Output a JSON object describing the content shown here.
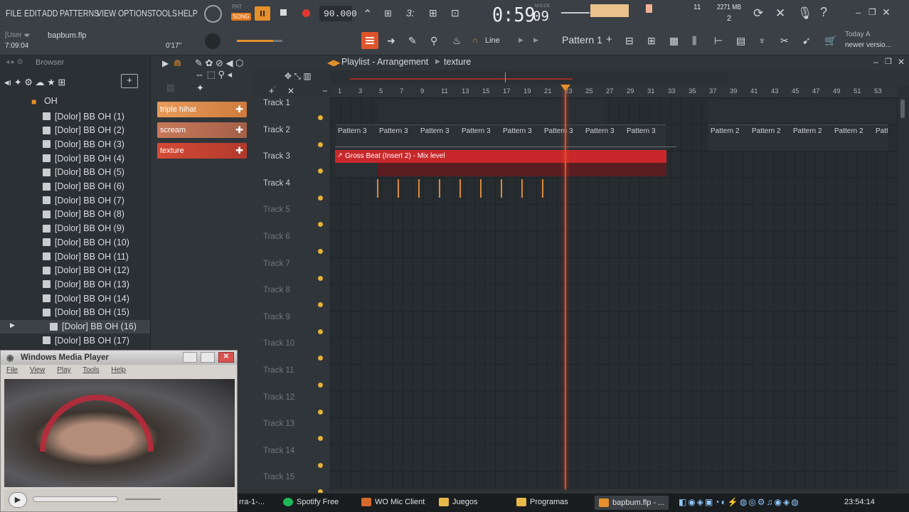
{
  "menu": {
    "items": [
      "FILE",
      "EDIT",
      "ADD",
      "PATTERNS",
      "VIEW",
      "OPTIONS",
      "TOOLS",
      "HELP"
    ],
    "pat_label": "PAT",
    "song_label": "SONG",
    "tempo": "90.000",
    "time_main": "0:59",
    "time_sub": "09",
    "time_unit": "M:S:CS",
    "cpu_value": "11",
    "mem": "2271 MB",
    "mem_sub": "2"
  },
  "hint": {
    "user": "[User",
    "file": "bapbum.flp",
    "duration": "7:09:04",
    "offset": "0'17\""
  },
  "toolbar": {
    "snap_mode": "Line",
    "pattern": "Pattern 1",
    "news_line1": "Today  A",
    "news_line2": "newer versio..."
  },
  "browser": {
    "title": "Browser",
    "folder": "OH",
    "items": [
      "[Dolor] BB OH (1)",
      "[Dolor] BB OH (2)",
      "[Dolor] BB OH (3)",
      "[Dolor] BB OH (4)",
      "[Dolor] BB OH (5)",
      "[Dolor] BB OH (6)",
      "[Dolor] BB OH (7)",
      "[Dolor] BB OH (8)",
      "[Dolor] BB OH (9)",
      "[Dolor] BB OH (10)",
      "[Dolor] BB OH (11)",
      "[Dolor] BB OH (12)",
      "[Dolor] BB OH (13)",
      "[Dolor] BB OH (14)",
      "[Dolor] BB OH (15)",
      "[Dolor] BB OH (16)",
      "[Dolor] BB OH (17)"
    ],
    "selected_index": 15
  },
  "playlist": {
    "title": "Playlist - Arrangement",
    "breadcrumb": "texture",
    "clips": [
      "triple hihat",
      "scream",
      "texture"
    ],
    "tracks": [
      "Track 1",
      "Track 2",
      "Track 3",
      "Track 4",
      "Track 5",
      "Track 6",
      "Track 7",
      "Track 8",
      "Track 9",
      "Track 10",
      "Track 11",
      "Track 12",
      "Track 13",
      "Track 14",
      "Track 15"
    ],
    "ruler": [
      "1",
      "3",
      "5",
      "7",
      "9",
      "11",
      "13",
      "15",
      "17",
      "19",
      "21",
      "23",
      "25",
      "27",
      "29",
      "31",
      "33",
      "35",
      "37",
      "39",
      "41",
      "43",
      "45",
      "47",
      "49",
      "51",
      "53"
    ],
    "pattern3": "Pattern 3",
    "pattern2": "Pattern 2",
    "automation": "Gross Beat (Insert 2) - Mix level"
  },
  "wmp": {
    "title": "Windows Media Player",
    "menu": [
      "File",
      "View",
      "Play",
      "Tools",
      "Help"
    ]
  },
  "taskbar": {
    "items": [
      "rra-1-...",
      "Spotify Free",
      "WO Mic Client",
      "Juegos",
      "Programas",
      "bapbum.flp - ..."
    ],
    "clock": "23:54:14"
  }
}
